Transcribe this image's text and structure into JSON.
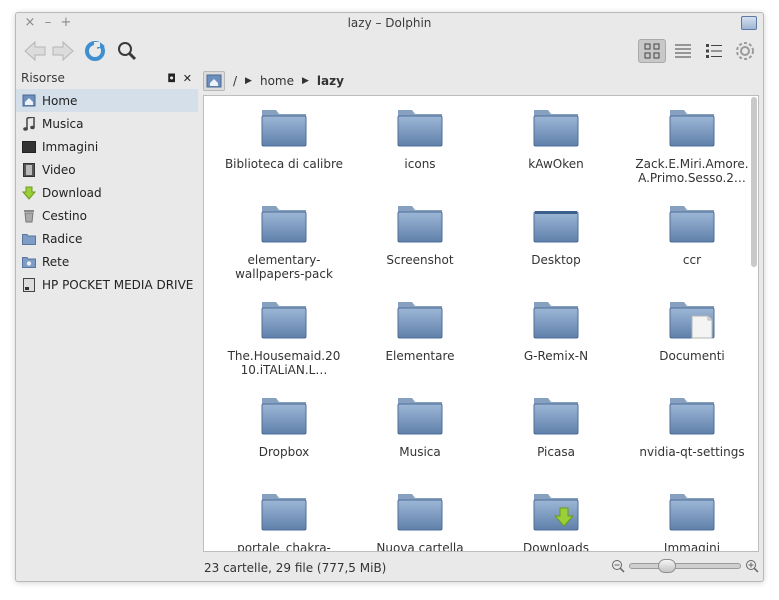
{
  "window": {
    "title": "lazy – Dolphin"
  },
  "titlebar": {
    "controls": [
      "×",
      "–",
      "+"
    ]
  },
  "toolbar": {
    "back_icon": "arrow-left-icon",
    "forward_icon": "arrow-right-icon",
    "reload_icon": "reload-icon",
    "search_icon": "search-icon",
    "view_modes": [
      "icons-view-icon",
      "compact-view-icon",
      "details-view-icon"
    ],
    "active_view": "icons",
    "settings_icon": "gear-icon"
  },
  "sidebar": {
    "title": "Risorse",
    "float_icon": "◘",
    "close_icon": "✕",
    "items": [
      {
        "label": "Home",
        "icon": "home-icon",
        "selected": true
      },
      {
        "label": "Musica",
        "icon": "music-icon"
      },
      {
        "label": "Immagini",
        "icon": "images-icon"
      },
      {
        "label": "Video",
        "icon": "video-icon"
      },
      {
        "label": "Download",
        "icon": "download-icon"
      },
      {
        "label": "Cestino",
        "icon": "trash-icon"
      },
      {
        "label": "Radice",
        "icon": "folder-icon"
      },
      {
        "label": "Rete",
        "icon": "network-icon"
      },
      {
        "label": "HP POCKET MEDIA DRIVE",
        "icon": "drive-icon"
      }
    ]
  },
  "breadcrumb": {
    "root": "/",
    "items": [
      {
        "label": "home"
      },
      {
        "label": "lazy"
      }
    ]
  },
  "files": [
    {
      "label": "Biblioteca di calibre",
      "type": "folder"
    },
    {
      "label": "icons",
      "type": "folder"
    },
    {
      "label": "kAwOken",
      "type": "folder"
    },
    {
      "label": "Zack.E.Miri.Amore.A.Primo.Sesso.2…",
      "type": "folder"
    },
    {
      "label": "elementary-wallpapers-pack",
      "type": "folder"
    },
    {
      "label": "Screenshot",
      "type": "folder"
    },
    {
      "label": "Desktop",
      "type": "desktop"
    },
    {
      "label": "ccr",
      "type": "folder"
    },
    {
      "label": "The.Housemaid.2010.iTALiAN.L…",
      "type": "folder"
    },
    {
      "label": "Elementare",
      "type": "folder"
    },
    {
      "label": "G-Remix-N",
      "type": "folder"
    },
    {
      "label": "Documenti",
      "type": "documents"
    },
    {
      "label": "Dropbox",
      "type": "folder"
    },
    {
      "label": "Musica",
      "type": "folder"
    },
    {
      "label": "Picasa",
      "type": "folder"
    },
    {
      "label": "nvidia-qt-settings",
      "type": "folder"
    },
    {
      "label": "portale_chakra-project_italia",
      "type": "folder"
    },
    {
      "label": "Nuova cartella",
      "type": "folder"
    },
    {
      "label": "Downloads",
      "type": "downloads"
    },
    {
      "label": "Immagini",
      "type": "folder"
    }
  ],
  "status": {
    "text": "23 cartelle, 29 file (777,5 MiB)",
    "zoom_out_icon": "zoom-out-icon",
    "zoom_in_icon": "zoom-in-icon",
    "zoom_level": 0.3
  },
  "colors": {
    "folder_light": "#9db6d6",
    "folder_dark": "#5f80aa",
    "selection": "#d4dfea",
    "reload_blue": "#3f8fd0"
  }
}
